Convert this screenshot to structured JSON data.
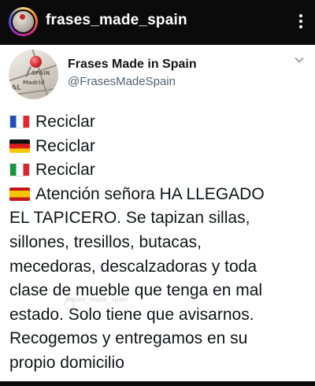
{
  "instagram_header": {
    "username": "frases_made_spain",
    "more_icon": "vertical-dots-icon"
  },
  "tweet_card": {
    "author_name": "Frases Made in Spain",
    "author_handle": "@FrasesMadeSpain",
    "avatar_map_words": [
      "SPAIN",
      "Madrid",
      "AL"
    ],
    "menu_icon": "chevron-down-icon",
    "lines": [
      {
        "flag": "flag-france-icon",
        "text": "Reciclar"
      },
      {
        "flag": "flag-germany-icon",
        "text": "Reciclar"
      },
      {
        "flag": "flag-italy-icon",
        "text": "Reciclar"
      },
      {
        "flag": "flag-spain-icon",
        "text": "Atención señora HA LLEGADO"
      },
      {
        "flag": "",
        "text": "EL TAPICERO. Se tapizan sillas,"
      },
      {
        "flag": "",
        "text": "sillones, tresillos, butacas,"
      },
      {
        "flag": "",
        "text": "mecedoras, descalzadoras y toda"
      },
      {
        "flag": "",
        "text": "clase de mueble que tenga en mal"
      },
      {
        "flag": "",
        "text": "estado. Solo tiene que avisarnos."
      },
      {
        "flag": "",
        "text": "Recogemos y entregamos en su"
      },
      {
        "flag": "",
        "text": "propio domicilio"
      }
    ],
    "watermark": "frases_made_spain"
  },
  "colors": {
    "background": "#0b0b0b",
    "card": "#ffffff",
    "text": "#0f1419",
    "handle": "#536471"
  }
}
